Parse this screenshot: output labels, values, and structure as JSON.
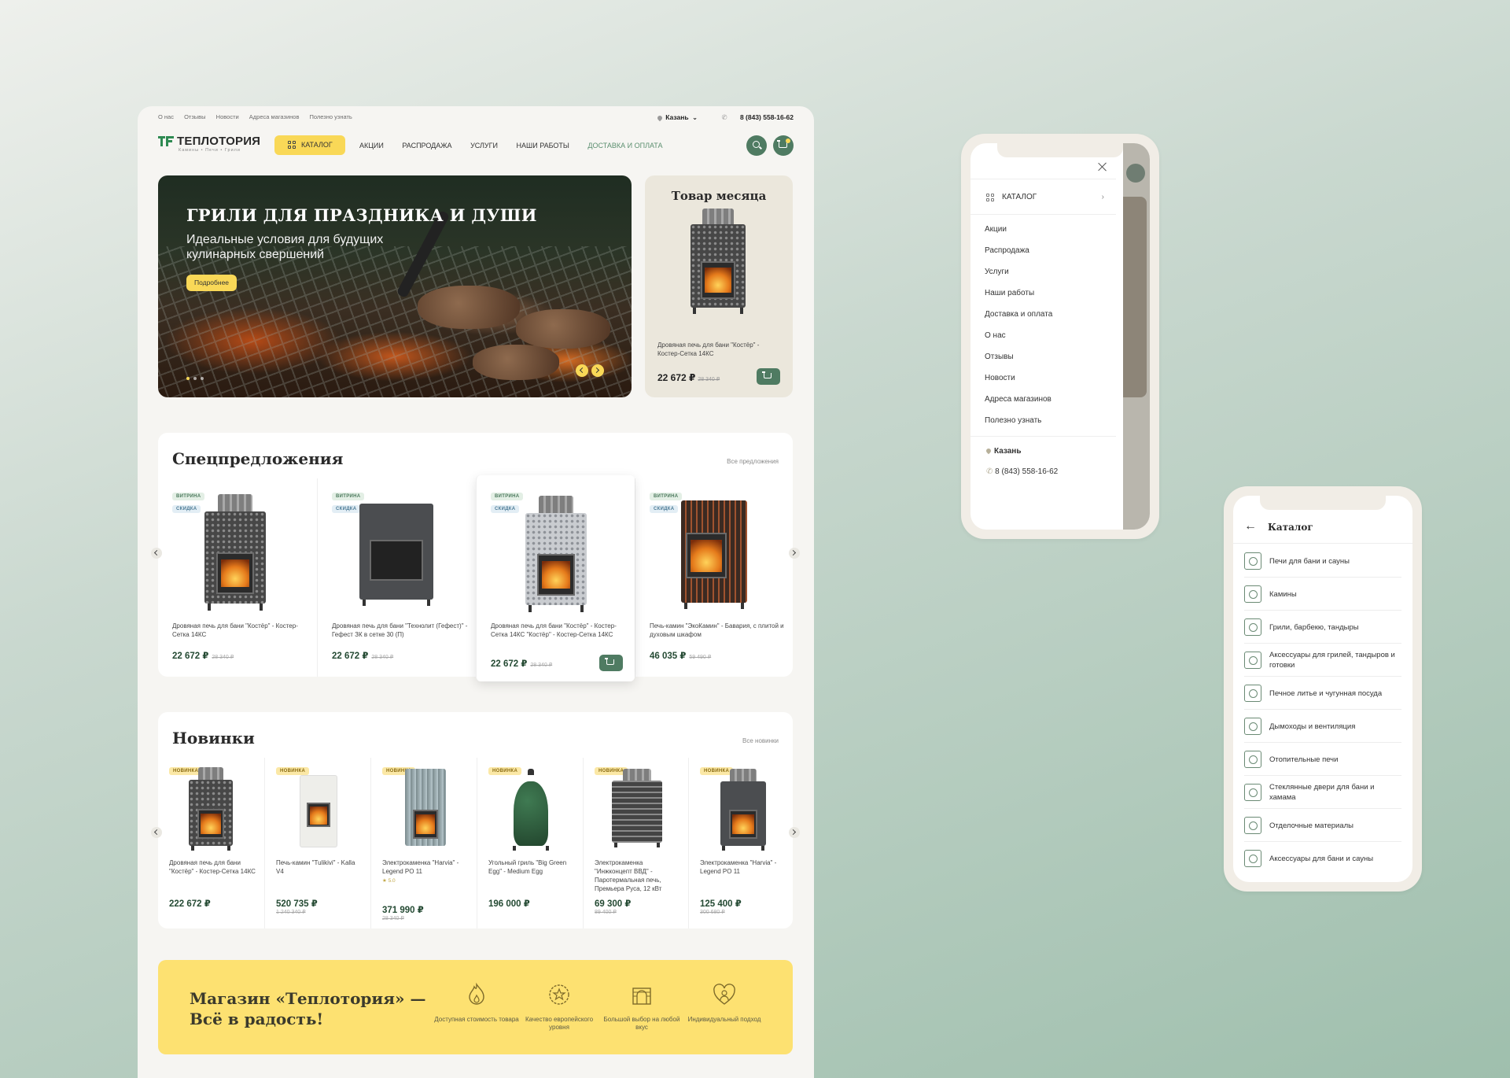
{
  "desktop": {
    "topbar": {
      "links": [
        "О нас",
        "Отзывы",
        "Новости",
        "Адреса магазинов",
        "Полезно узнать"
      ],
      "city": "Казань",
      "phone": "8 (843) 558-16-62"
    },
    "logo": {
      "name": "ТЕПЛОТОРИЯ",
      "sub": "Камины • Печи • Грили"
    },
    "catalog_button": "КАТАЛОГ",
    "nav": [
      "АКЦИИ",
      "РАСПРОДАЖА",
      "УСЛУГИ",
      "НАШИ РАБОТЫ",
      "ДОСТАВКА И ОПЛАТА"
    ],
    "hero": {
      "title": "ГРИЛИ ДЛЯ ПРАЗДНИКА И ДУШИ",
      "subtitle": "Идеальные условия для будущих кулинарных свершений",
      "button": "Подробнее"
    },
    "month": {
      "title": "Товар месяца",
      "name": "Дровяная печь для бани \"Костёр\" - Костер-Сетка 14КС",
      "price": "22 672 ₽",
      "old_price": "28 340 ₽"
    },
    "special": {
      "title": "Спецпредложения",
      "all": "Все предложения",
      "items": [
        {
          "b1": "ВИТРИНА",
          "b2": "СКИДКА",
          "name": "Дровяная печь для бани \"Костёр\" - Костер-Сетка 14КС",
          "price": "22 672 ₽",
          "old": "28 340 ₽"
        },
        {
          "b1": "ВИТРИНА",
          "b2": "СКИДКА",
          "name": "Дровяная печь для бани \"Технолит (Гефест)\" - Гефест ЗК в сетке 30 (П)",
          "price": "22 672 ₽",
          "old": "28 340 ₽"
        },
        {
          "b1": "ВИТРИНА",
          "b2": "СКИДКА",
          "name": "Дровяная печь для бани \"Костёр\" - Костер-Сетка 14КС \"Костёр\" - Костер-Сетка 14КС",
          "price": "22 672 ₽",
          "old": "28 340 ₽"
        },
        {
          "b1": "ВИТРИНА",
          "b2": "СКИДКА",
          "name": "Печь-камин \"ЭкоКамин\" - Бавария, с плитой и духовым шкафом",
          "price": "46 035 ₽",
          "old": "59 490 ₽"
        }
      ]
    },
    "news": {
      "title": "Новинки",
      "all": "Все новинки",
      "items": [
        {
          "badge": "НОВИНКА",
          "name": "Дровяная печь для бани \"Костёр\" - Костер-Сетка 14КС",
          "price": "222 672 ₽",
          "old": "",
          "rating": ""
        },
        {
          "badge": "НОВИНКА",
          "name": "Печь-камин \"Tulikivi\" - Kalla V4",
          "price": "520 735 ₽",
          "old": "1 240 340 ₽",
          "rating": ""
        },
        {
          "badge": "НОВИНКА",
          "name": "Электрокаменка \"Harvia\" - Legend PO 11",
          "price": "371 990 ₽",
          "old": "28 340 ₽",
          "rating": "★ 5.0"
        },
        {
          "badge": "НОВИНКА",
          "name": "Угольный гриль \"Big Green Egg\" - Medium Egg",
          "price": "196 000 ₽",
          "old": "",
          "rating": ""
        },
        {
          "badge": "НОВИНКА",
          "name": "Электрокаменка \"Инжконцепт ВВД\" - Паротермальная печь, Премьера Руса, 12 кВт",
          "price": "69 300 ₽",
          "old": "89 400 ₽",
          "rating": ""
        },
        {
          "badge": "НОВИНКА",
          "name": "Электрокаменка \"Harvia\" - Legend PO 11",
          "price": "125 400 ₽",
          "old": "300 680 ₽",
          "rating": ""
        }
      ]
    },
    "promo": {
      "title_1": "Магазин «Теплотория» —",
      "title_2": "Всё в радость!",
      "features": [
        "Доступная стоимость товара",
        "Качество европейского уровня",
        "Большой выбор на любой вкус",
        "Индивидуальный подход"
      ]
    }
  },
  "phone_menu": {
    "catalog": "КАТАЛОГ",
    "items": [
      "Акции",
      "Распродажа",
      "Услуги",
      "Наши работы",
      "Доставка и оплата",
      "О нас",
      "Отзывы",
      "Новости",
      "Адреса магазинов",
      "Полезно узнать"
    ],
    "city": "Казань",
    "phone": "8 (843) 558-16-62"
  },
  "phone_catalog": {
    "title": "Каталог",
    "items": [
      "Печи для бани и сауны",
      "Камины",
      "Грили, барбекю, тандыры",
      "Аксессуары для грилей, тандыров и готовки",
      "Печное литье и чугунная посуда",
      "Дымоходы и вентиляция",
      "Отопительные печи",
      "Стеклянные двери для бани и хамама",
      "Отделочные материалы",
      "Аксессуары для бани и сауны"
    ]
  },
  "colors": {
    "accent_yellow": "#f9d857",
    "brand_green": "#4f7b62",
    "logo_green": "#2e8a52"
  }
}
